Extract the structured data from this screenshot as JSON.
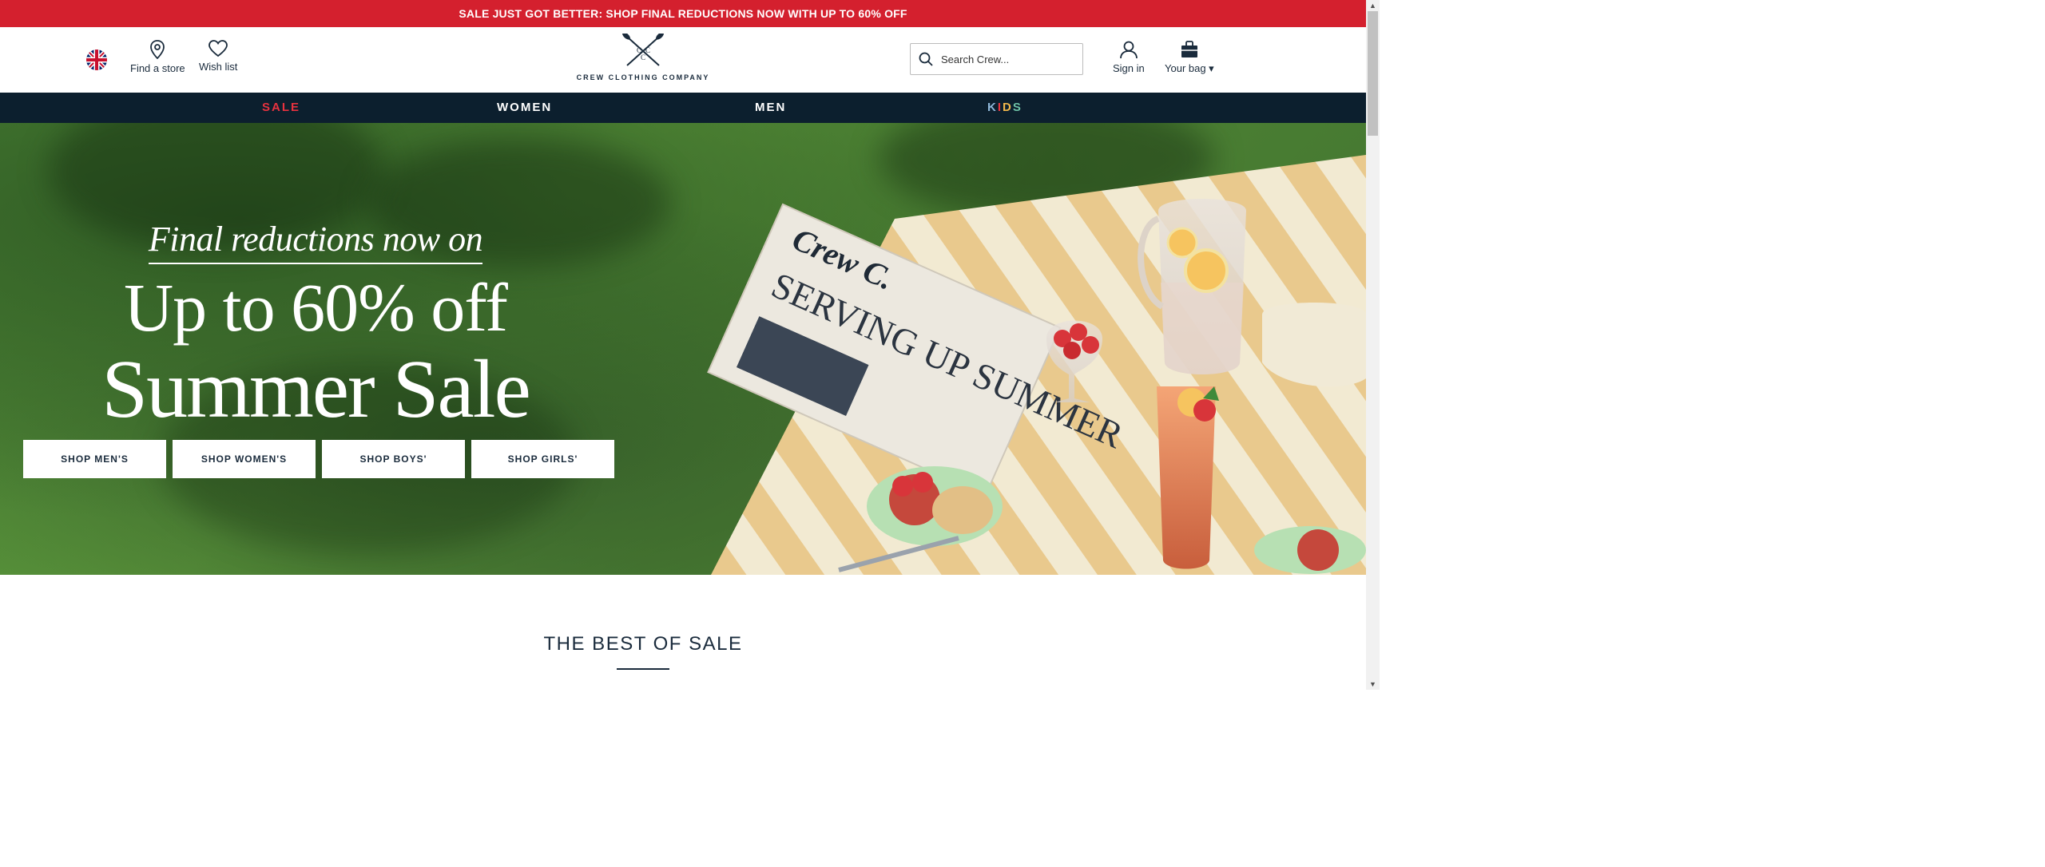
{
  "promo": {
    "text": "SALE JUST GOT BETTER: SHOP FINAL REDUCTIONS NOW WITH UP TO 60% OFF",
    "background": "#d4202e"
  },
  "header": {
    "find_store": "Find a store",
    "wish_list": "Wish list",
    "logo_text": "CREW CLOTHING COMPANY",
    "search_placeholder": "Search Crew...",
    "sign_in": "Sign in",
    "bag": "Your bag ▾",
    "icons": [
      "uk-flag-icon",
      "location-pin-icon",
      "heart-icon",
      "search-icon",
      "user-icon",
      "bag-icon"
    ]
  },
  "nav": {
    "items": [
      {
        "label": "SALE",
        "color": "#e8323f"
      },
      {
        "label": "WOMEN",
        "color": "#ffffff"
      },
      {
        "label": "MEN",
        "color": "#ffffff"
      },
      {
        "label": "KIDS",
        "color": "multicolor"
      }
    ],
    "kids_letters": [
      "K",
      "I",
      "D",
      "S"
    ],
    "kids_colors": [
      "#8fb7d9",
      "#e8323f",
      "#f2b84b",
      "#6fc3a7"
    ],
    "background": "#0c1f2e"
  },
  "hero": {
    "eyebrow": "Final reductions now on",
    "subtitle": "Up to 60% off",
    "title": "Summer Sale",
    "newspaper_brand": "Crew C.",
    "newspaper_headline": "SERVING UP SUMMER",
    "ctas": [
      "SHOP MEN'S",
      "SHOP WOMEN'S",
      "SHOP BOYS'",
      "SHOP GIRLS'"
    ]
  },
  "section": {
    "title": "THE BEST OF SALE"
  },
  "colors": {
    "navy": "#1a2b3c",
    "brand_red": "#d4202e"
  }
}
